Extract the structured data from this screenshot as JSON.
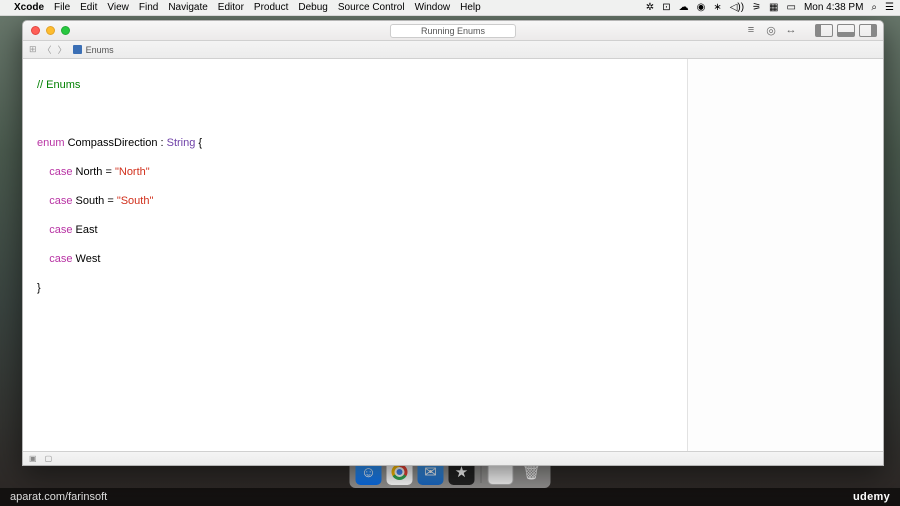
{
  "menubar": {
    "app": "Xcode",
    "items": [
      "File",
      "Edit",
      "View",
      "Find",
      "Navigate",
      "Editor",
      "Product",
      "Debug",
      "Source Control",
      "Window",
      "Help"
    ],
    "clock": "Mon 4:38 PM"
  },
  "window": {
    "title": "Running Enums",
    "tab": "Enums"
  },
  "code": {
    "l1_comment": "// Enums",
    "l3_kw1": "enum",
    "l3_name": " CompassDirection : ",
    "l3_type": "String",
    "l3_brace": " {",
    "l4_kw": "    case",
    "l4_rest": " North = ",
    "l4_str": "\"North\"",
    "l5_kw": "    case",
    "l5_rest": " South = ",
    "l5_str": "\"South\"",
    "l6_kw": "    case",
    "l6_rest": " East",
    "l7_kw": "    case",
    "l7_rest": " West",
    "l8": "}"
  },
  "footer": {
    "left": "aparat.com/farinsoft",
    "right": "udemy"
  }
}
